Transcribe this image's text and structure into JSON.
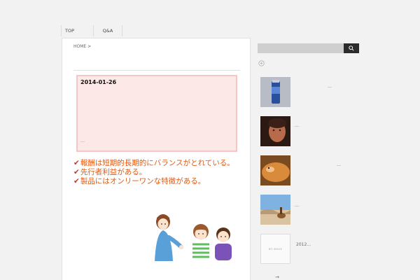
{
  "nav": {
    "items": [
      "TOP",
      "Q&A"
    ]
  },
  "breadcrumb": {
    "home": "HOME",
    "separator": ">"
  },
  "post": {
    "date": "2014-01-26",
    "more": "…"
  },
  "features": [
    "報酬は短期的長期的にバランスがとれている。",
    "先行者利益がある。",
    "製品にはオンリーワンな特徴がある。"
  ],
  "sidebar": {
    "search": {
      "placeholder": ""
    },
    "posts": [
      {
        "text": "…",
        "thumb": "product-bottle"
      },
      {
        "text": "…",
        "thumb": "person-face"
      },
      {
        "text": "…",
        "thumb": "dog"
      },
      {
        "text": "…",
        "thumb": "desert-rider"
      },
      {
        "text": "2012…",
        "thumb": "no-image",
        "noimage_label": "NO IMAGE"
      }
    ],
    "more_arrow": "→"
  },
  "colors": {
    "feature_text": "#e25a10",
    "check": "#c0392b",
    "post_bg": "#fde8e8",
    "post_border": "#f5c6c6"
  }
}
